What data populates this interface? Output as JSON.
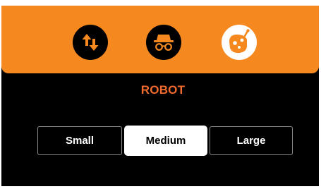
{
  "header": {
    "modes": [
      {
        "icon": "transfer-arrows-icon"
      },
      {
        "icon": "incognito-icon"
      },
      {
        "icon": "robot-icon",
        "selected": true
      }
    ]
  },
  "section": {
    "title": "ROBOT"
  },
  "size_selector": {
    "options": [
      "Small",
      "Medium",
      "Large"
    ],
    "selected": "Medium"
  },
  "colors": {
    "accent": "#f5891f",
    "title": "#f26b2c",
    "background": "#000000",
    "selected_bg": "#ffffff"
  }
}
